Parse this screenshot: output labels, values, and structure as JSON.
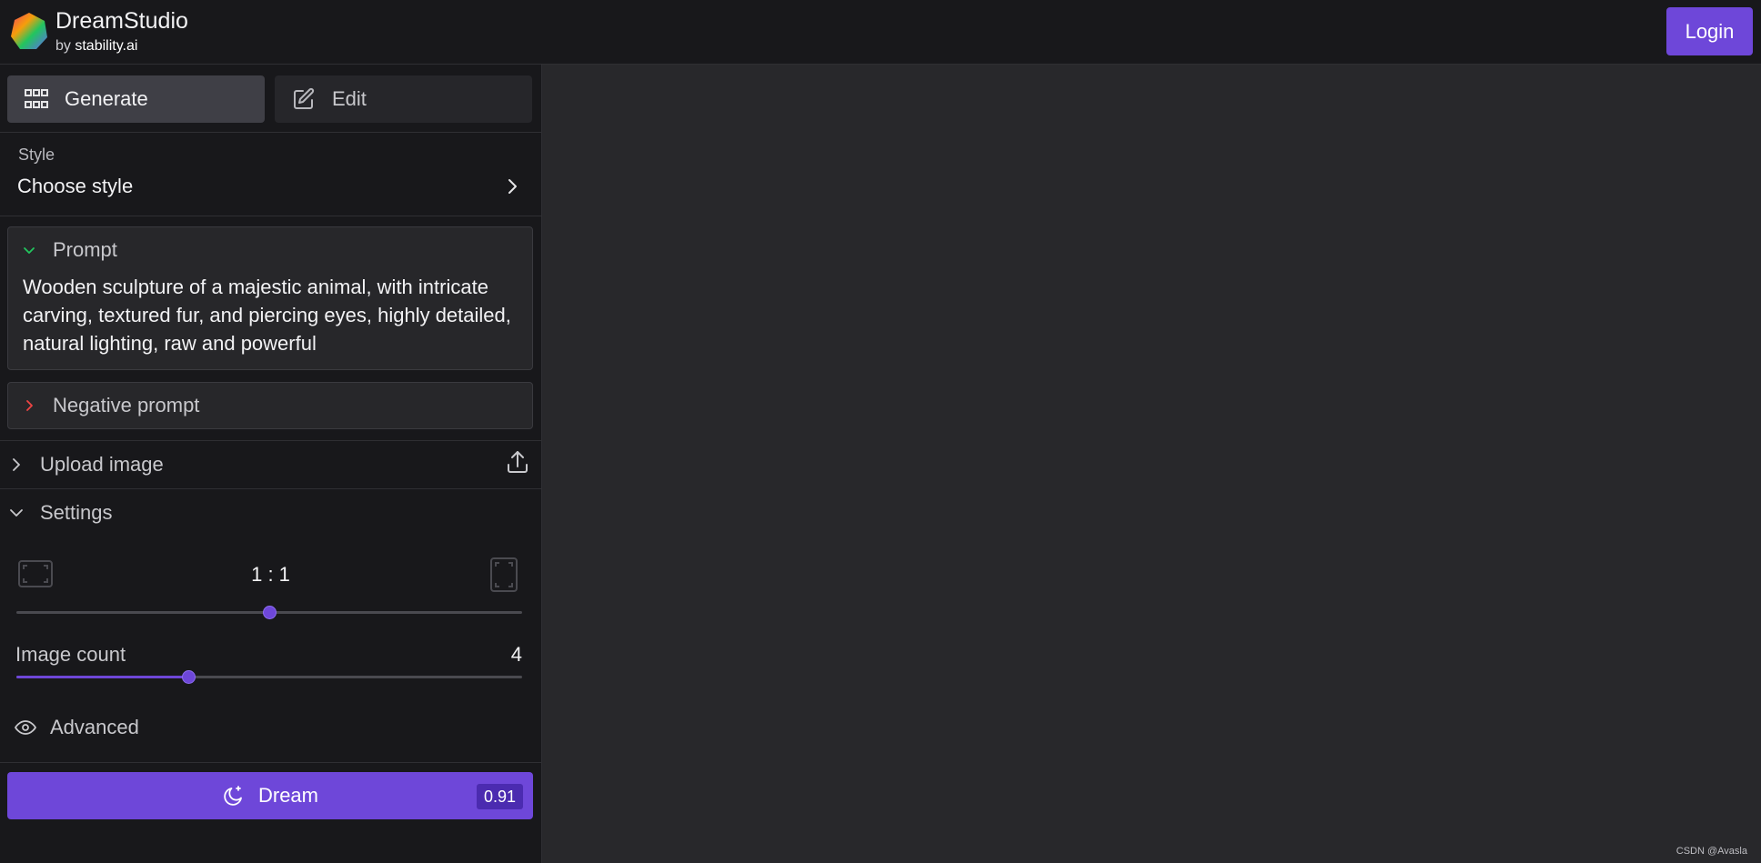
{
  "header": {
    "brand_name": "DreamStudio",
    "brand_by": "by",
    "brand_company": "stability.ai",
    "login_label": "Login"
  },
  "tabs": [
    {
      "label": "Generate",
      "icon": "grid-icon",
      "active": true
    },
    {
      "label": "Edit",
      "icon": "edit-icon",
      "active": false
    }
  ],
  "style": {
    "label": "Style",
    "value": "Choose style"
  },
  "prompt": {
    "label": "Prompt",
    "text": "Wooden sculpture of a majestic animal, with intricate carving, textured fur, and piercing eyes, highly detailed, natural lighting, raw and powerful",
    "chevron_color": "#22c55e"
  },
  "negative_prompt": {
    "label": "Negative prompt",
    "chevron_color": "#ef4444"
  },
  "upload": {
    "label": "Upload image"
  },
  "settings": {
    "label": "Settings",
    "aspect_ratio": "1 : 1",
    "aspect_slider_value": 0.5,
    "image_count_label": "Image count",
    "image_count": "4",
    "image_count_slider_value": 0.34,
    "advanced_label": "Advanced"
  },
  "dream": {
    "label": "Dream",
    "cost": "0.91"
  },
  "watermark": "CSDN @Avasla",
  "colors": {
    "accent": "#6e47d9",
    "background": "#28282b",
    "sidebar": "#18181b"
  }
}
